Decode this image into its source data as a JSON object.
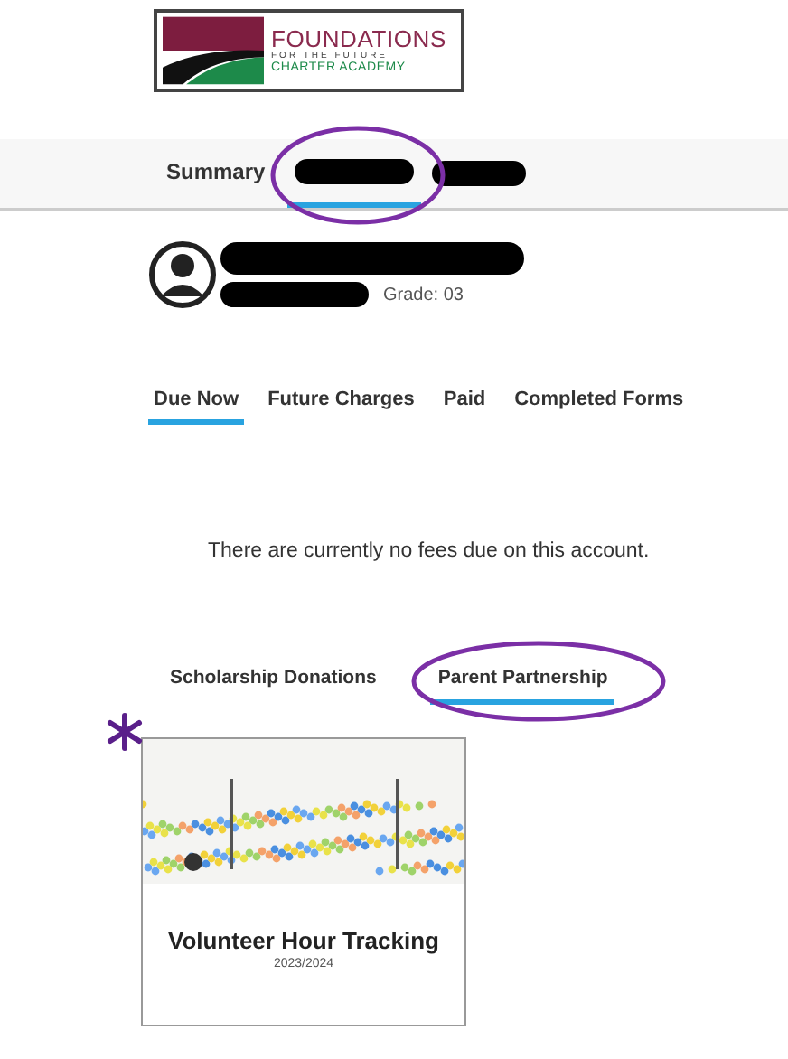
{
  "logo": {
    "title": "FOUNDATIONS",
    "tagline": "FOR THE FUTURE",
    "subtitle": "CHARTER ACADEMY"
  },
  "top_tabs": [
    {
      "kind": "text",
      "label": "Summary",
      "selected": false
    },
    {
      "kind": "redacted",
      "selected": true
    }
  ],
  "student": {
    "grade": "Grade: 03"
  },
  "fee_tabs": [
    {
      "label": "Due Now",
      "selected": true
    },
    {
      "label": "Future Charges",
      "selected": false
    },
    {
      "label": "Paid",
      "selected": false
    },
    {
      "label": "Completed Forms",
      "selected": false
    }
  ],
  "message": "There are currently no fees due on this account.",
  "section_tabs": [
    {
      "label": "Scholarship Donations",
      "selected": false
    },
    {
      "label": "Parent Partnership",
      "selected": true
    }
  ],
  "cards": [
    {
      "title": "Volunteer Hour Tracking",
      "year": "2023/2024"
    }
  ]
}
